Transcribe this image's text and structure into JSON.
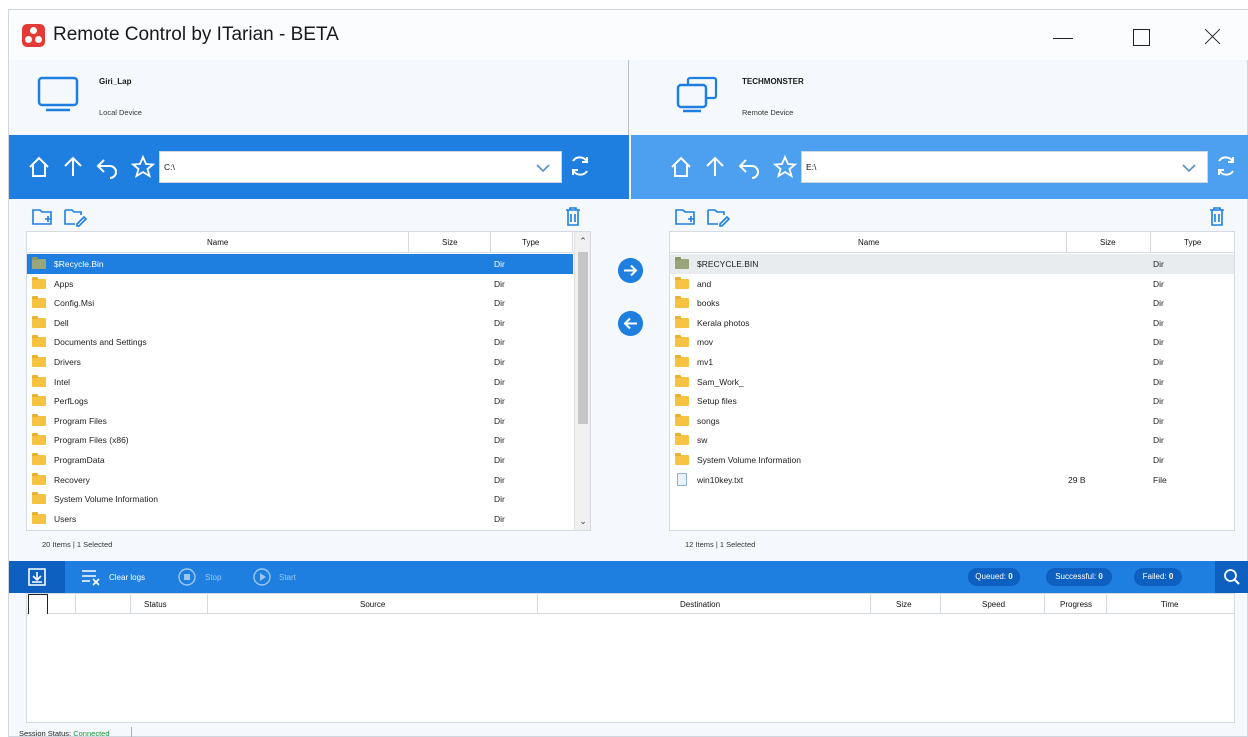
{
  "window": {
    "title": "Remote Control by ITarian - BETA"
  },
  "local": {
    "device_name": "Giri_Lap",
    "device_role": "Local Device",
    "path": "C:\\",
    "item_count": "20 Items | 1 Selected",
    "columns": [
      "Name",
      "Size",
      "Type"
    ],
    "files": [
      {
        "name": "$Recycle.Bin",
        "size": "",
        "type": "Dir",
        "icon": "folder-recycle-icon",
        "selected": true
      },
      {
        "name": "Apps",
        "size": "",
        "type": "Dir",
        "icon": "folder-icon"
      },
      {
        "name": "Config.Msi",
        "size": "",
        "type": "Dir",
        "icon": "folder-icon"
      },
      {
        "name": "Dell",
        "size": "",
        "type": "Dir",
        "icon": "folder-icon"
      },
      {
        "name": "Documents and Settings",
        "size": "",
        "type": "Dir",
        "icon": "folder-icon"
      },
      {
        "name": "Drivers",
        "size": "",
        "type": "Dir",
        "icon": "folder-icon"
      },
      {
        "name": "Intel",
        "size": "",
        "type": "Dir",
        "icon": "folder-icon"
      },
      {
        "name": "PerfLogs",
        "size": "",
        "type": "Dir",
        "icon": "folder-icon"
      },
      {
        "name": "Program Files",
        "size": "",
        "type": "Dir",
        "icon": "folder-icon"
      },
      {
        "name": "Program Files (x86)",
        "size": "",
        "type": "Dir",
        "icon": "folder-icon"
      },
      {
        "name": "ProgramData",
        "size": "",
        "type": "Dir",
        "icon": "folder-icon"
      },
      {
        "name": "Recovery",
        "size": "",
        "type": "Dir",
        "icon": "folder-icon"
      },
      {
        "name": "System Volume Information",
        "size": "",
        "type": "Dir",
        "icon": "folder-icon"
      },
      {
        "name": "Users",
        "size": "",
        "type": "Dir",
        "icon": "folder-icon"
      }
    ]
  },
  "remote": {
    "device_name": "TECHMONSTER",
    "device_role": "Remote Device",
    "path": "E:\\",
    "item_count": "12 Items | 1 Selected",
    "columns": [
      "Name",
      "Size",
      "Type"
    ],
    "files": [
      {
        "name": "$RECYCLE.BIN",
        "size": "",
        "type": "Dir",
        "icon": "folder-recycle-icon",
        "selected": true
      },
      {
        "name": "and",
        "size": "",
        "type": "Dir",
        "icon": "folder-icon"
      },
      {
        "name": "books",
        "size": "",
        "type": "Dir",
        "icon": "folder-icon"
      },
      {
        "name": "Kerala photos",
        "size": "",
        "type": "Dir",
        "icon": "folder-icon"
      },
      {
        "name": "mov",
        "size": "",
        "type": "Dir",
        "icon": "folder-icon"
      },
      {
        "name": "mv1",
        "size": "",
        "type": "Dir",
        "icon": "folder-icon"
      },
      {
        "name": "Sam_Work_",
        "size": "",
        "type": "Dir",
        "icon": "folder-icon"
      },
      {
        "name": "Setup files",
        "size": "",
        "type": "Dir",
        "icon": "folder-icon"
      },
      {
        "name": "songs",
        "size": "",
        "type": "Dir",
        "icon": "folder-icon"
      },
      {
        "name": "sw",
        "size": "",
        "type": "Dir",
        "icon": "folder-icon"
      },
      {
        "name": "System Volume Information",
        "size": "",
        "type": "Dir",
        "icon": "folder-icon"
      },
      {
        "name": "win10key.txt",
        "size": "29 B",
        "type": "File",
        "icon": "text-file-icon"
      }
    ]
  },
  "transfer": {
    "clear_logs": "Clear logs",
    "stop": "Stop",
    "start": "Start",
    "queued_label": "Queued:",
    "queued": "0",
    "successful_label": "Successful:",
    "successful": "0",
    "failed_label": "Failed:",
    "failed": "0",
    "columns": [
      "Status",
      "Source",
      "Destination",
      "Size",
      "Speed",
      "Progress",
      "Time"
    ]
  },
  "session": {
    "label": "Session Status:",
    "value": "Connected"
  },
  "colors": {
    "accent": "#1e7fe0",
    "accent_dark": "#0d5fc0",
    "remote_bar": "#4d9ff0",
    "connected": "#1a9a3a"
  }
}
